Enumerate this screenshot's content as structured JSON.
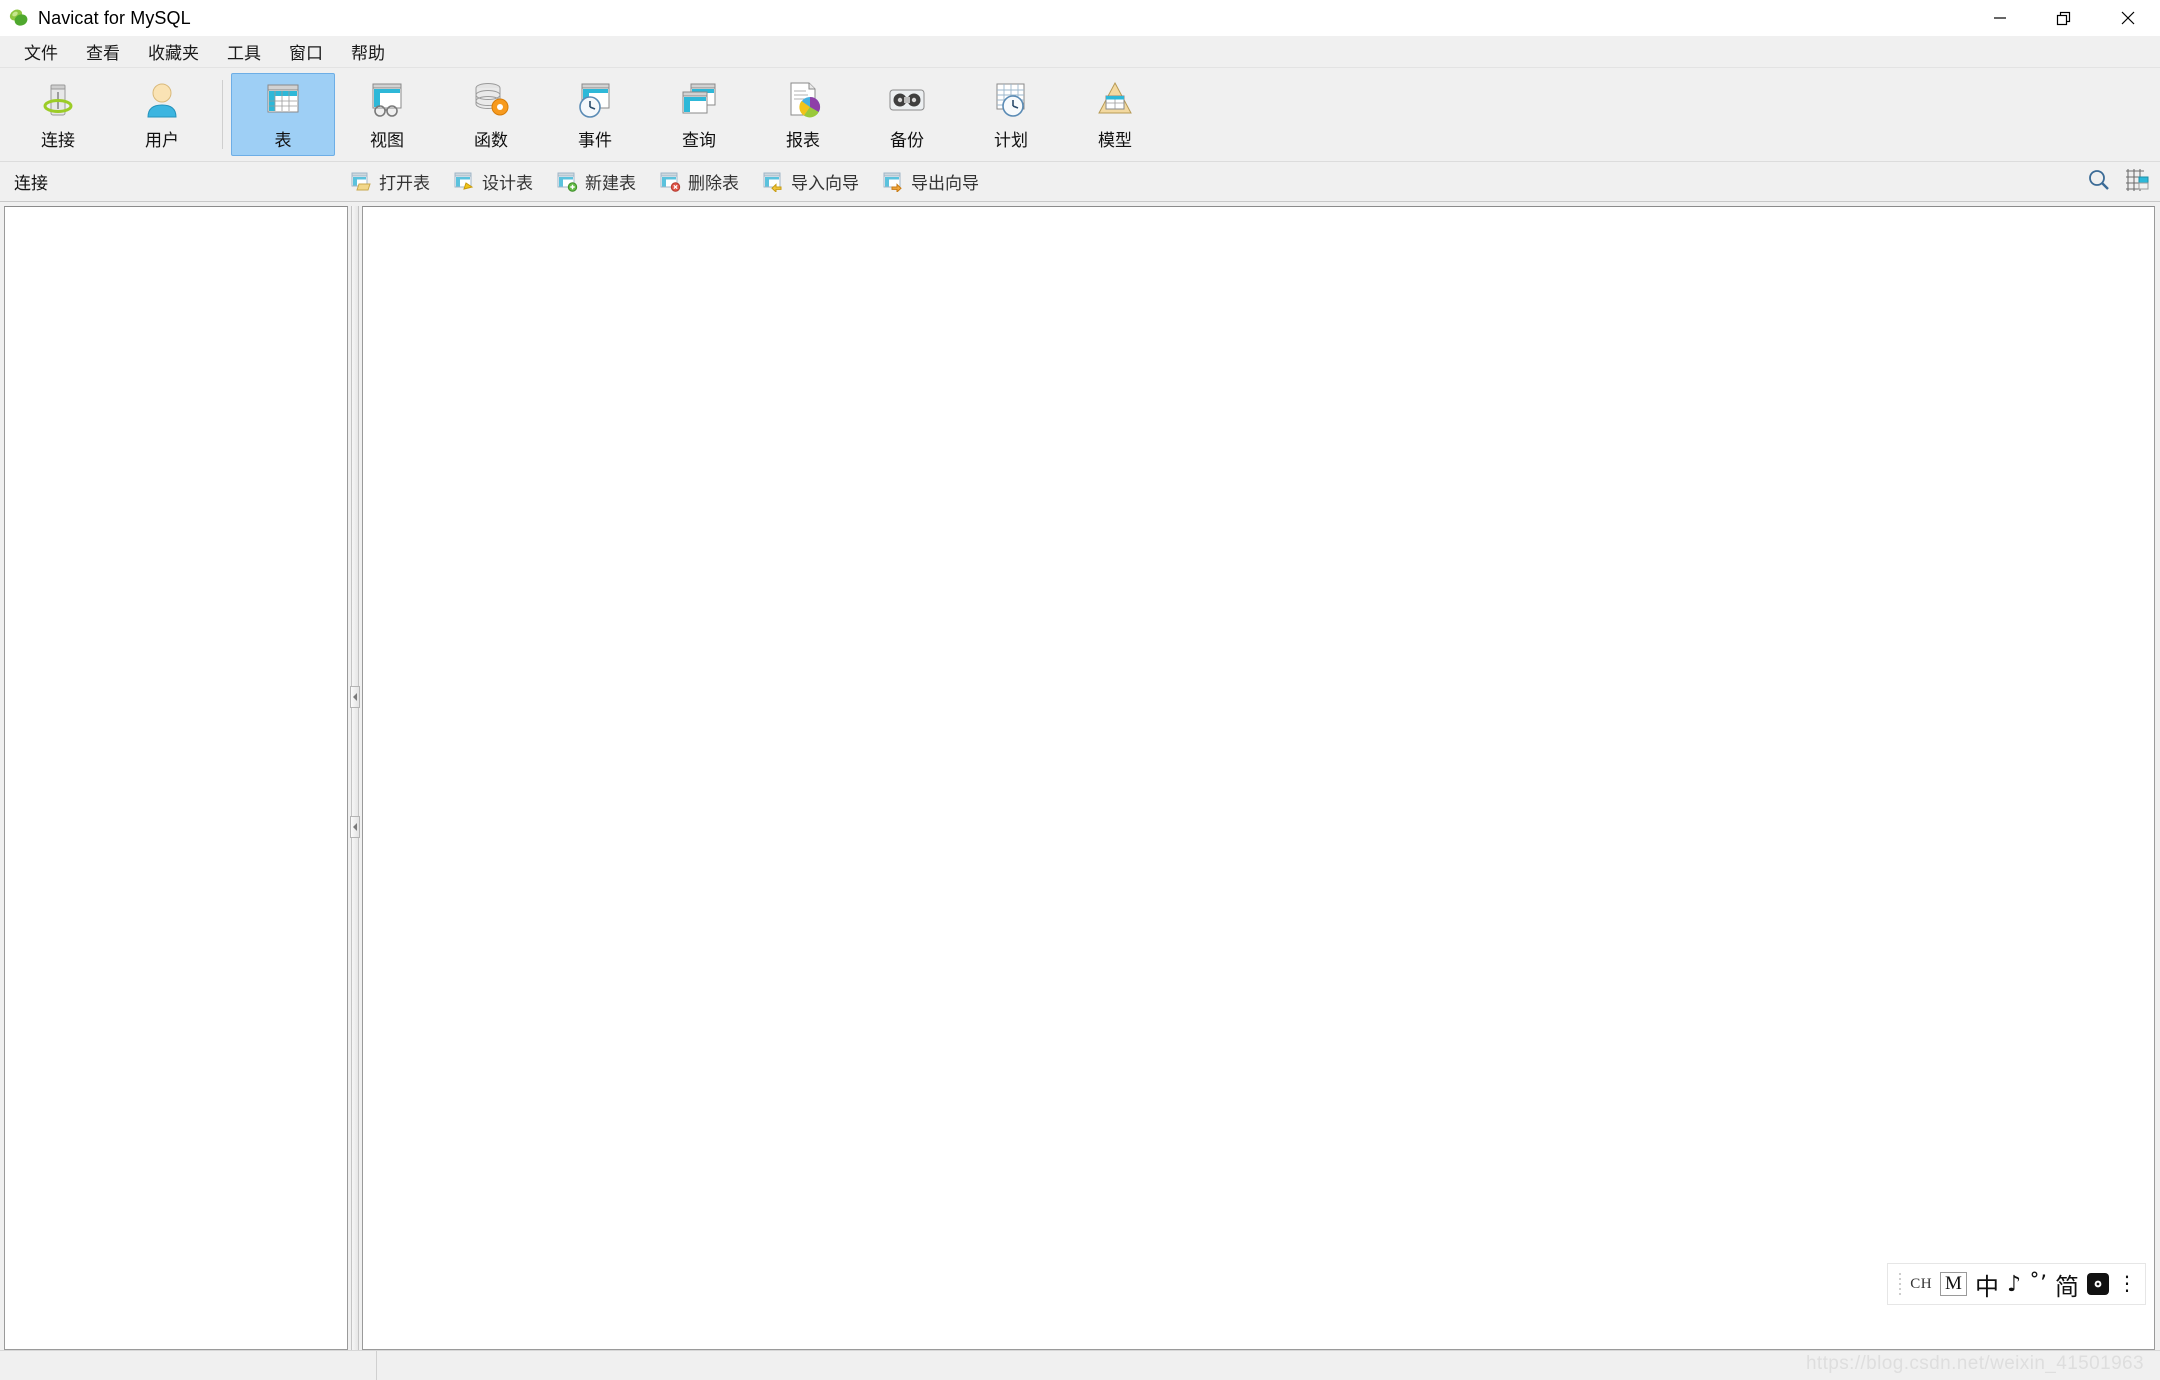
{
  "window": {
    "title": "Navicat for MySQL",
    "logo_icon": "navicat-leaf-icon",
    "controls": [
      {
        "name": "minimize",
        "icon": "minimize-icon",
        "glyph": "—"
      },
      {
        "name": "restore",
        "icon": "restore-icon",
        "glyph": "❐"
      },
      {
        "name": "close",
        "icon": "close-icon",
        "glyph": "✕"
      }
    ]
  },
  "menubar": {
    "items": [
      {
        "label": "文件"
      },
      {
        "label": "查看"
      },
      {
        "label": "收藏夹"
      },
      {
        "label": "工具"
      },
      {
        "label": "窗口"
      },
      {
        "label": "帮助"
      }
    ]
  },
  "toolbar": {
    "selected": "表",
    "groups": [
      {
        "buttons": [
          {
            "label": "连接",
            "icon": "connection-icon",
            "selected": false
          },
          {
            "label": "用户",
            "icon": "user-icon",
            "selected": false
          }
        ]
      },
      {
        "buttons": [
          {
            "label": "表",
            "icon": "table-icon",
            "selected": true
          },
          {
            "label": "视图",
            "icon": "view-icon",
            "selected": false
          },
          {
            "label": "函数",
            "icon": "function-icon",
            "selected": false
          },
          {
            "label": "事件",
            "icon": "event-icon",
            "selected": false
          },
          {
            "label": "查询",
            "icon": "query-icon",
            "selected": false
          },
          {
            "label": "报表",
            "icon": "report-icon",
            "selected": false
          },
          {
            "label": "备份",
            "icon": "backup-icon",
            "selected": false
          },
          {
            "label": "计划",
            "icon": "schedule-icon",
            "selected": false
          },
          {
            "label": "模型",
            "icon": "model-icon",
            "selected": false
          }
        ]
      }
    ]
  },
  "subtoolbar": {
    "section_label": "连接",
    "buttons": [
      {
        "label": "打开表",
        "icon": "open-table-icon"
      },
      {
        "label": "设计表",
        "icon": "design-table-icon"
      },
      {
        "label": "新建表",
        "icon": "new-table-icon"
      },
      {
        "label": "删除表",
        "icon": "delete-table-icon"
      },
      {
        "label": "导入向导",
        "icon": "import-wizard-icon"
      },
      {
        "label": "导出向导",
        "icon": "export-wizard-icon"
      }
    ],
    "right_icons": [
      {
        "name": "search-icon"
      },
      {
        "name": "grid-view-icon"
      }
    ]
  },
  "panels": {
    "left": {
      "name": "connection-tree-panel",
      "content": ""
    },
    "splitter": {
      "name": "panel-splitter",
      "collapse_glyph": "◀"
    },
    "right": {
      "name": "object-list-panel",
      "content": ""
    }
  },
  "statusbar": {
    "cell1": "",
    "cell2": "",
    "watermark": "https://blog.csdn.net/weixin_41501963"
  },
  "ime": {
    "language": "CH",
    "mode_badge": "M",
    "chinese_mode": "中",
    "punctuation": "♪",
    "symbol": "˚’",
    "simplified": "简",
    "settings_icon": "ime-settings-icon",
    "more_glyph": "⋮"
  },
  "colors": {
    "accent_selected": "#9ecff5",
    "accent_border": "#6daee6",
    "chrome_bg": "#f0f0f0",
    "panel_bg": "#ffffff",
    "panel_border": "#9a9a9a",
    "watermark": "#dedede"
  }
}
